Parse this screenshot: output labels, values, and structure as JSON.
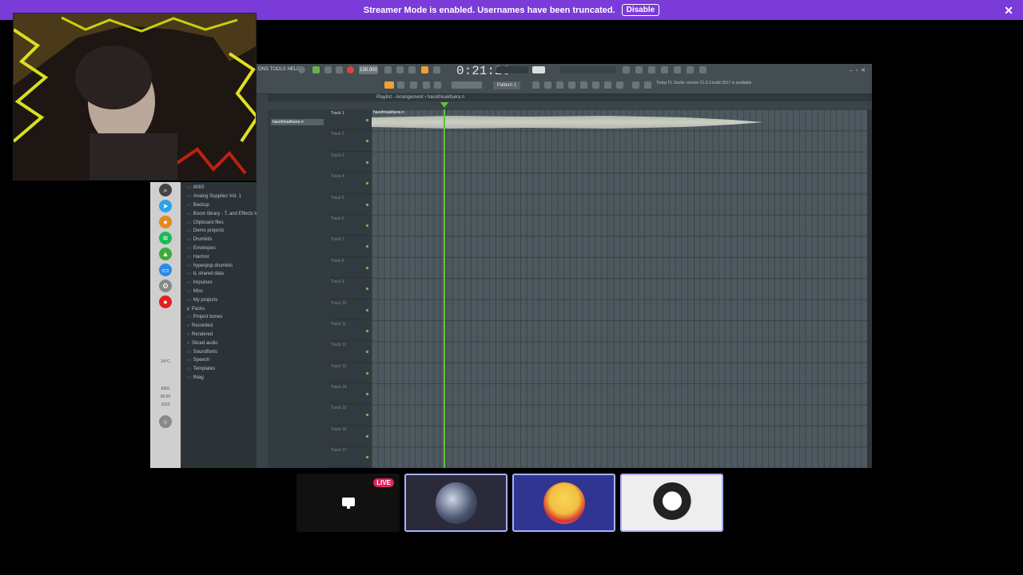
{
  "banner": {
    "message": "Streamer Mode is enabled. Usernames have been truncated.",
    "disable_label": "Disable"
  },
  "taskbar": {
    "weather": "24°C",
    "lang": "ENG",
    "clock_time": "00:00",
    "clock_date": "2023"
  },
  "browser": {
    "items": [
      "808S",
      "Analog Supplies Vol. 1",
      "Backup",
      "Boom library - T..and Effects WAV",
      "Clipboard files",
      "Demo projects",
      "Drumkits",
      "Envelopes",
      "Harmor",
      "hyperpop drumkits",
      "IL shared data",
      "Impulses",
      "Misc",
      "My projects",
      "Packs",
      "Project bones",
      "Recorded",
      "Rendered",
      "Sliced audio",
      "Soundfonts",
      "Speech",
      "Templates",
      "thiag"
    ]
  },
  "fl": {
    "menu": "ONS TOOLS HELP",
    "tempo": "130.000",
    "time": "0:21:26",
    "pattern": "Pattern 1",
    "news": "Today  FL Studio version 21.0.3 build 3517 is available",
    "playlist_title": "Playlist - Arrangement › hacefrioakfuera n",
    "clip_name": "hacefrioakfuera n",
    "wave_label": "hacefrioakfuera n",
    "tracks": [
      "Track 1",
      "Track 2",
      "Track 3",
      "Track 4",
      "Track 5",
      "Track 6",
      "Track 7",
      "Track 8",
      "Track 9",
      "Track 10",
      "Track 11",
      "Track 12",
      "Track 13",
      "Track 14",
      "Track 15",
      "Track 16",
      "Track 17"
    ]
  },
  "call": {
    "live_label": "LIVE"
  }
}
